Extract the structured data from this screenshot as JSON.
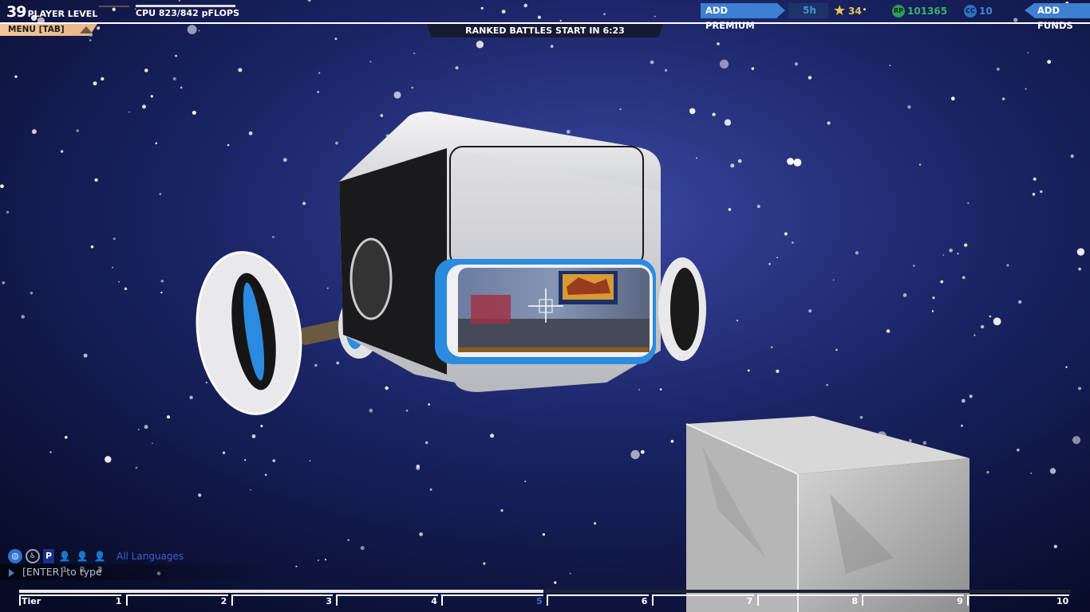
{
  "header": {
    "player_level_num": "39",
    "player_level_label": "PLAYER LEVEL",
    "cpu": "CPU 823/842 pFLOPS",
    "menu": "MENU [TAB]",
    "ranked": "RANKED BATTLES START IN 6:23"
  },
  "currency": {
    "add_premium": "ADD PREMIUM",
    "premium_value": "5h",
    "stars": "34",
    "rp_icon": "RP",
    "rp": "101365",
    "cc_icon": "CC",
    "cc": "10",
    "add_funds": "ADD FUNDS"
  },
  "chat": {
    "p_label": "P",
    "party1": "1",
    "party2": "2",
    "party3": "3",
    "language": "All Languages",
    "placeholder": "[ENTER] to type"
  },
  "tiers": {
    "label": "Tier",
    "items": [
      "1",
      "2",
      "3",
      "4",
      "5",
      "6",
      "7",
      "8",
      "9",
      "10"
    ],
    "current": "5"
  },
  "icons": {
    "globe": "globe-icon",
    "wheel": "wheelchair-icon",
    "star": "star-icon",
    "rp": "robit-icon",
    "cc": "cosmetic-credit-icon"
  },
  "colors": {
    "accent": "#3d7fd1",
    "menu_tab": "#f3c79a",
    "rp": "#35b569",
    "stars": "#e8c35a",
    "cc": "#3f84d6"
  }
}
